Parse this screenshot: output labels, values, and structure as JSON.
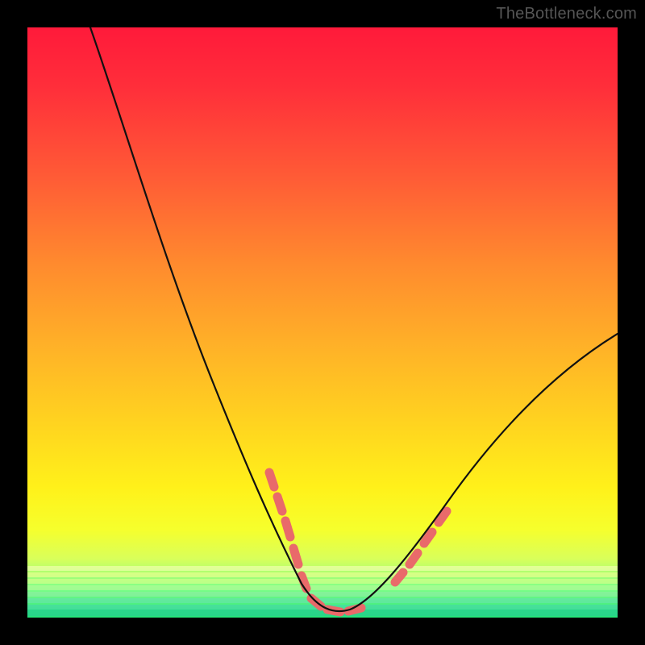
{
  "watermark": "TheBottleneck.com",
  "colors": {
    "background": "#000000",
    "curve": "#111111",
    "marker": "#e96a6a",
    "gradient_top": "#ff1a3a",
    "gradient_bottom": "#22e27a"
  },
  "chart_data": {
    "type": "line",
    "title": "",
    "xlabel": "",
    "ylabel": "",
    "xlim": [
      0,
      100
    ],
    "ylim": [
      0,
      100
    ],
    "series": [
      {
        "name": "bottleneck-curve",
        "x": [
          10,
          15,
          20,
          25,
          30,
          35,
          38,
          40,
          42,
          44,
          46,
          48,
          50,
          52,
          54,
          56,
          60,
          65,
          70,
          75,
          80,
          85,
          90,
          95,
          100
        ],
        "y": [
          100,
          89,
          77,
          65,
          53,
          39,
          30,
          24,
          18,
          12,
          7,
          4,
          2,
          1,
          1,
          2,
          5,
          11,
          19,
          27,
          34,
          41,
          47,
          52,
          56
        ]
      }
    ],
    "markers": [
      {
        "name": "left-shoulder",
        "x_start": 40,
        "x_end": 47
      },
      {
        "name": "valley-floor",
        "x_start": 48,
        "x_end": 56
      },
      {
        "name": "right-shoulder",
        "x_start": 62,
        "x_end": 70
      }
    ],
    "annotations": []
  }
}
